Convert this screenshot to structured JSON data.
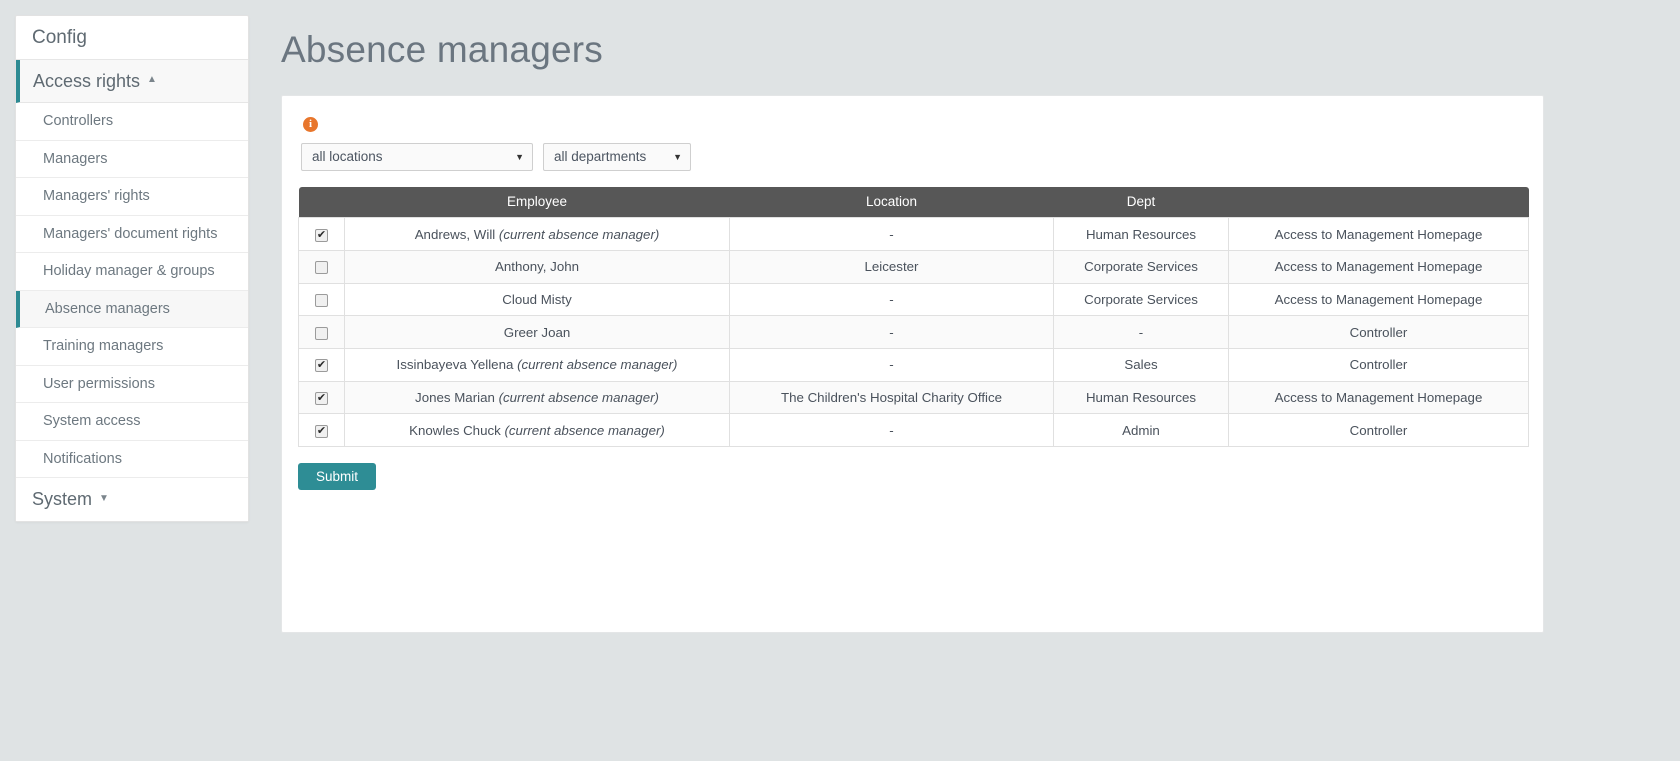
{
  "sidebar": {
    "header": "Config",
    "groups": [
      {
        "label": "Access rights",
        "caret": "▲",
        "state": "expanded"
      }
    ],
    "items": [
      {
        "label": "Controllers"
      },
      {
        "label": "Managers"
      },
      {
        "label": "Managers' rights"
      },
      {
        "label": "Managers' document rights"
      },
      {
        "label": "Holiday manager & groups"
      },
      {
        "label": "Absence managers"
      },
      {
        "label": "Training managers"
      },
      {
        "label": "User permissions"
      },
      {
        "label": "System access"
      },
      {
        "label": "Notifications"
      }
    ],
    "selected_item": "Absence managers",
    "footer_group": {
      "label": "System",
      "caret": "▼",
      "state": "collapsed"
    }
  },
  "main": {
    "title": "Absence managers",
    "info_icon_glyph": "i",
    "filters": {
      "location": {
        "value": "all locations",
        "arrow": "▼"
      },
      "department": {
        "value": "all departments",
        "arrow": "▼"
      }
    },
    "table": {
      "columns": [
        "",
        "Employee",
        "Location",
        "Dept",
        ""
      ],
      "rows": [
        {
          "checked": true,
          "employee": "Andrews, Will ",
          "employee_note": "(current absence manager)",
          "location": "-",
          "dept": "Human Resources",
          "rights": "Access to Management Homepage"
        },
        {
          "checked": false,
          "employee": "Anthony, John",
          "employee_note": "",
          "location": "Leicester",
          "dept": "Corporate Services",
          "rights": "Access to Management Homepage"
        },
        {
          "checked": false,
          "employee": "Cloud Misty",
          "employee_note": "",
          "location": "-",
          "dept": "Corporate Services",
          "rights": "Access to Management Homepage"
        },
        {
          "checked": false,
          "employee": "Greer Joan",
          "employee_note": "",
          "location": "-",
          "dept": "-",
          "rights": "Controller"
        },
        {
          "checked": true,
          "employee": "Issinbayeva Yellena ",
          "employee_note": "(current absence manager)",
          "location": "-",
          "dept": "Sales",
          "rights": "Controller"
        },
        {
          "checked": true,
          "employee": "Jones Marian ",
          "employee_note": "(current absence manager)",
          "location": "The Children's Hospital Charity Office",
          "dept": "Human Resources",
          "rights": "Access to Management Homepage"
        },
        {
          "checked": true,
          "employee": "Knowles Chuck ",
          "employee_note": "(current absence manager)",
          "location": "-",
          "dept": "Admin",
          "rights": "Controller"
        }
      ]
    },
    "submit_label": "Submit"
  },
  "colors": {
    "accent_teal": "#2e8d95",
    "info_orange": "#e8762c",
    "table_header": "#575757",
    "page_bg": "#dfe3e4"
  }
}
